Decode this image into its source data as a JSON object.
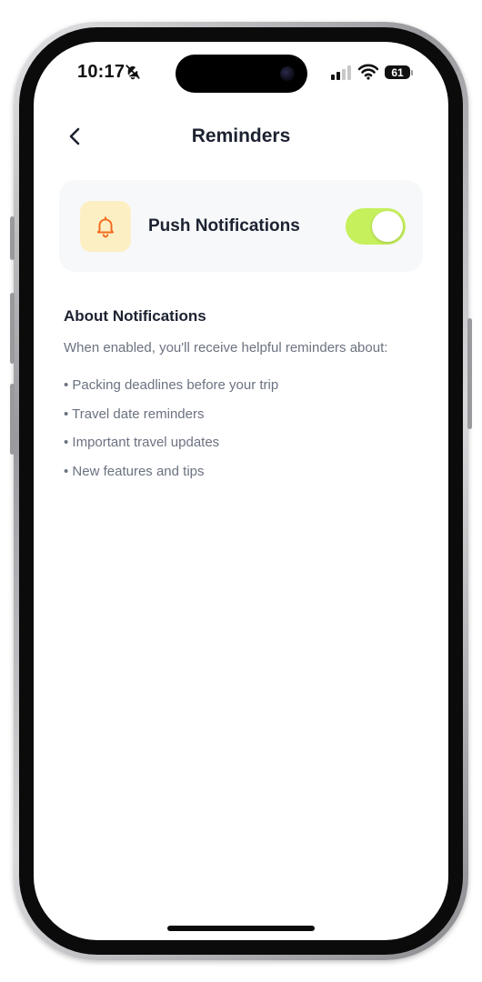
{
  "status_bar": {
    "time": "10:17",
    "battery": "61",
    "icons": [
      "bell-slash-icon",
      "cellular-signal-icon",
      "wifi-icon",
      "battery-icon"
    ]
  },
  "header": {
    "title": "Reminders",
    "back_icon": "chevron-left-icon"
  },
  "push_card": {
    "icon": "bell-icon",
    "label": "Push Notifications",
    "enabled": true
  },
  "about": {
    "title": "About Notifications",
    "description": "When enabled, you'll receive helpful reminders about:",
    "items": [
      "• Packing deadlines before your trip",
      "• Travel date reminders",
      "• Important travel updates",
      "• New features and tips"
    ]
  },
  "colors": {
    "accent_toggle": "#c6f05c",
    "icon_bg": "#fdefc4",
    "icon_stroke": "#f26b1d",
    "title_text": "#1c2230",
    "muted_text": "#6b7280",
    "card_bg": "#f7f8fa"
  }
}
